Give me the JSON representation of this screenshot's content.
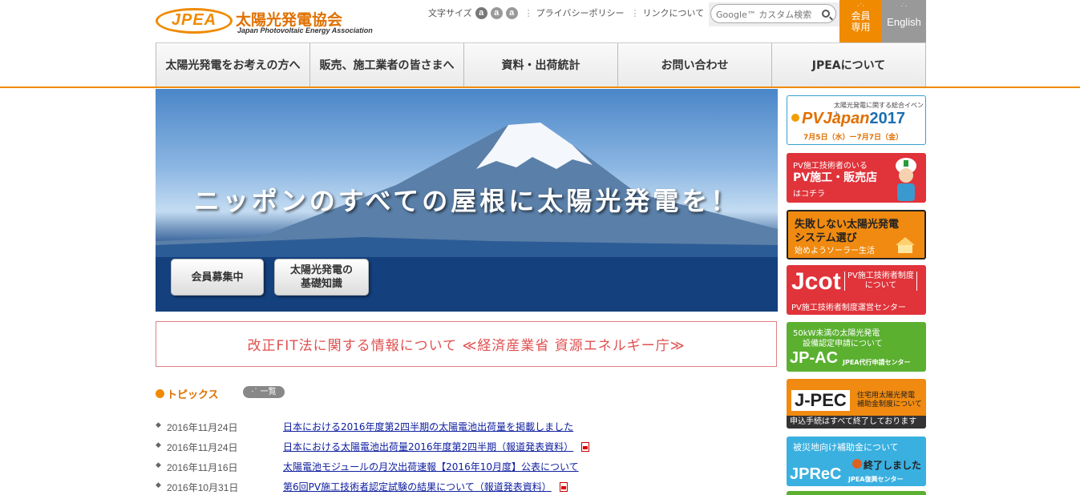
{
  "header": {
    "logo_mark": "JPEA",
    "logo_jp": "太陽光発電協会",
    "logo_en": "Japan Photovoltaic Energy Association",
    "font_size_label": "文字サイズ",
    "font_sizes": [
      "a",
      "a",
      "a"
    ],
    "privacy_link": "プライバシーポリシー",
    "links_link": "リンクについて",
    "search_placeholder": "Google™ カスタム検索",
    "member_label_1": "会員",
    "member_label_2": "専用",
    "english_label": "English"
  },
  "nav": {
    "items": [
      "太陽光発電をお考えの方へ",
      "販売、施工業者の皆さまへ",
      "資料・出荷統計",
      "お問い合わせ",
      "JPEAについて"
    ]
  },
  "hero": {
    "caption": "ニッポンのすべての屋根に太陽光発電を！",
    "button_member": "会員募集中",
    "button_basics_1": "太陽光発電の",
    "button_basics_2": "基礎知識"
  },
  "fit_banner": {
    "text": "改正FIT法に関する情報について ≪経済産業省 資源エネルギー庁≫"
  },
  "topics": {
    "title": "トピックス",
    "list_button": "一覧",
    "items": [
      {
        "date": "2016年11月24日",
        "title": "日本における2016年度第2四半期の太陽電池出荷量を掲載しました",
        "pdf": false
      },
      {
        "date": "2016年11月24日",
        "title": "日本における太陽電池出荷量2016年度第2四半期（報道発表資料）",
        "pdf": true
      },
      {
        "date": "2016年11月16日",
        "title": "太陽電池モジュールの月次出荷速報【2016年10月度】公表について",
        "pdf": false
      },
      {
        "date": "2016年10月31日",
        "title": "第6回PV施工技術者認定試験の結果について（報道発表資料）",
        "pdf": true
      }
    ]
  },
  "sidebar": {
    "pvjapan": {
      "small": "太陽光発電に関する総合イベント",
      "main": "PVJapan",
      "year": "2017",
      "dates": "7月5日（水）ー7月7日（金）"
    },
    "shop": {
      "l1": "PV施工技術者のいる",
      "l2": "PV施工・販売店",
      "l3": "はコチラ"
    },
    "system": {
      "l1": "失敗しない太陽光発電",
      "l2": "システム選び",
      "l3": "始めようソーラー生活"
    },
    "jcot": {
      "main": "Jcot",
      "br1": "PV施工技術者制度",
      "br2": "について",
      "sub": "PV施工技術者制度運営センター"
    },
    "jpac": {
      "l1": "50kW未満の太陽光発電",
      "l2": "設備認定申請について",
      "main": "JP-AC",
      "sub": "JPEA代行申請センター"
    },
    "jpec": {
      "main": "J-PEC",
      "r1": "住宅用太陽光発電",
      "r2": "補助金制度について",
      "foot": "申込手続はすべて終了しております"
    },
    "jprec": {
      "l1": "被災地向け補助金について",
      "end": "終了しました",
      "main": "JPReC",
      "sub": "JPEA復興センター"
    }
  },
  "colors": {
    "accent": "#f08a00",
    "link": "#1020a0",
    "fit_red": "#e05050"
  }
}
